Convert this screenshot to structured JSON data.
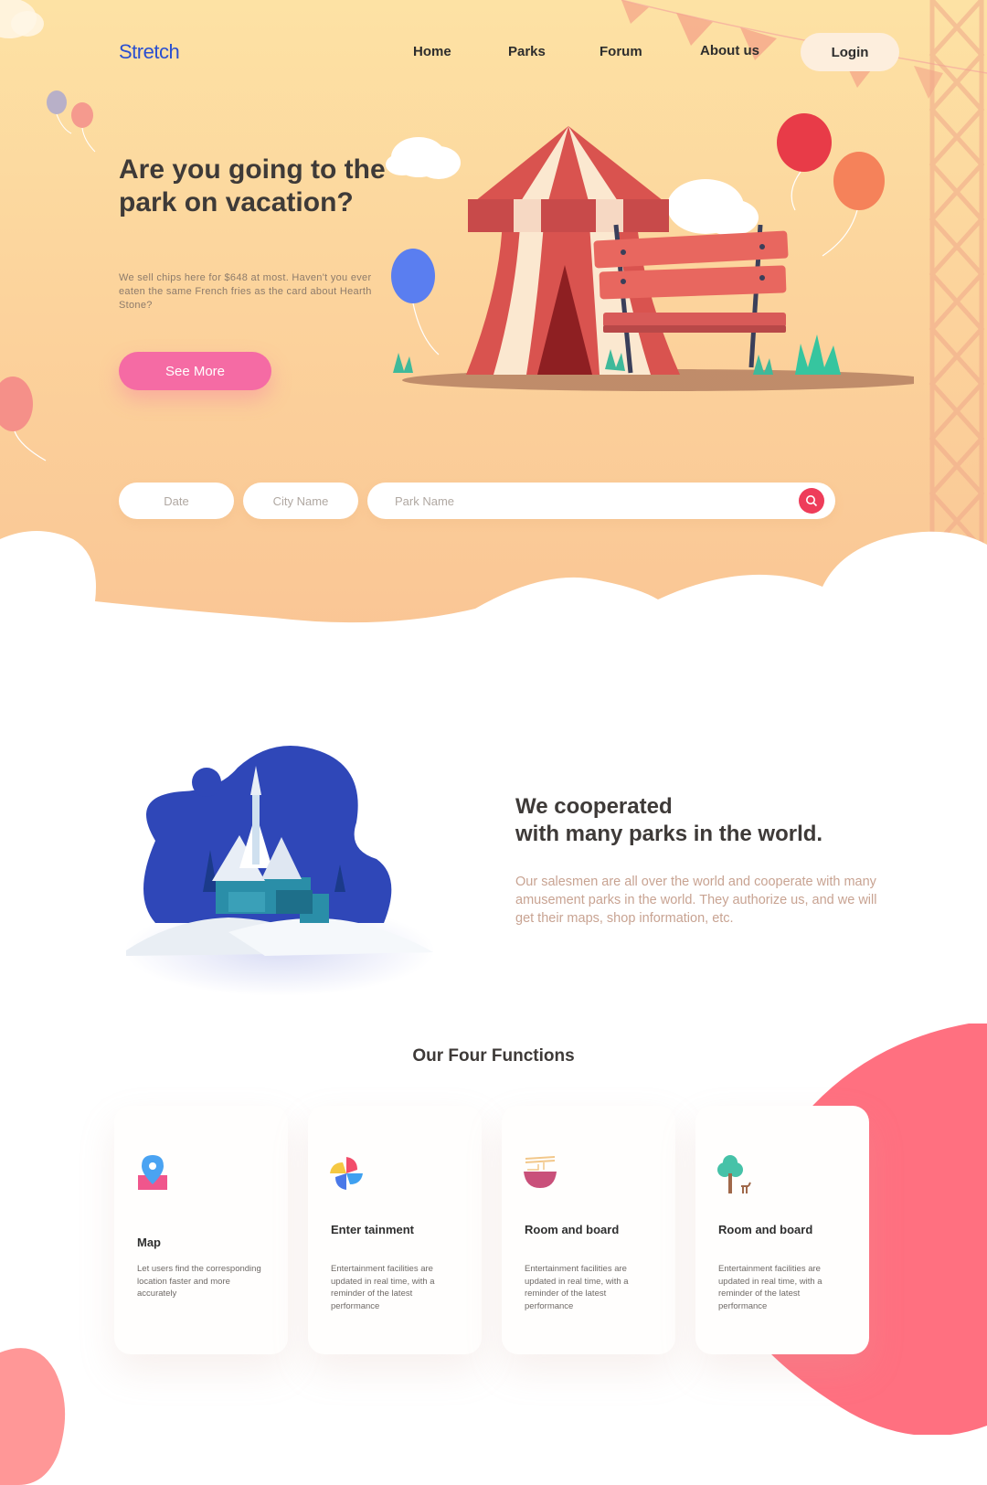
{
  "nav": {
    "logo": "Stretch",
    "links": [
      "Home",
      "Parks",
      "Forum",
      "About us"
    ],
    "login_label": "Login"
  },
  "hero": {
    "title": "Are you going to the park on vacation?",
    "subtitle": "We sell chips here for $648 at most. Haven't you ever eaten the same French fries as the card about Hearth Stone?",
    "cta_label": "See More"
  },
  "search": {
    "date_placeholder": "Date",
    "city_placeholder": "City Name",
    "park_placeholder": "Park Name"
  },
  "partners": {
    "title_line1": "We cooperated",
    "title_line2": "with many parks in the world.",
    "description": "Our salesmen are all over the world and cooperate with many amusement parks in the world. They authorize us, and we will get their maps, shop information, etc."
  },
  "functions": {
    "title": "Our Four Functions",
    "cards": [
      {
        "icon": "map-pin-icon",
        "title": "Map",
        "description": "Let users find the corresponding location faster and more accurately"
      },
      {
        "icon": "pinwheel-icon",
        "title": "Enter tainment",
        "description": "Entertainment facilities are updated in real time, with a reminder of the latest performance"
      },
      {
        "icon": "noodle-bowl-icon",
        "title": "Room and board",
        "description": "Entertainment facilities are updated in real time, with a reminder of the latest performance"
      },
      {
        "icon": "tree-icon",
        "title": "Room and board",
        "description": "Entertainment facilities are updated in real time, with a reminder of the latest performance"
      }
    ]
  },
  "colors": {
    "hero_top": "#fde2a4",
    "hero_bottom": "#f9c494",
    "cta_pink": "#f56ba4",
    "search_red": "#ee3d5a",
    "blob_coral": "#ff7080",
    "logo_blue": "#2a4fd0",
    "castle_blue": "#2f47b8"
  }
}
